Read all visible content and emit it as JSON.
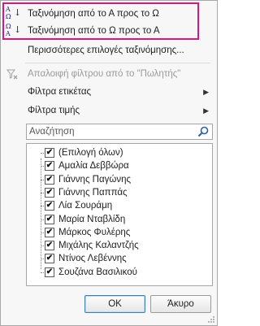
{
  "menu": {
    "sort_asc": "Ταξινόμηση από το Α προς το Ω",
    "sort_desc": "Ταξινόμηση από το Ω προς το Α",
    "more_sort": "Περισσότερες επιλογές ταξινόμησης...",
    "clear_filter": "Απαλοιφή φίλτρου από το \"Πωλητής\"",
    "label_filters": "Φίλτρα ετικέτας",
    "value_filters": "Φίλτρα τιμής",
    "sort_icon_top": "A",
    "sort_icon_bottom": "Ω",
    "sort_icon_top_desc": "Ω",
    "sort_icon_bottom_desc": "A",
    "submenu_arrow": "▶"
  },
  "search": {
    "placeholder": "Αναζήτηση"
  },
  "list": {
    "items": [
      {
        "label": "(Επιλογή όλων)",
        "checked": true
      },
      {
        "label": "Αμαλία Δεββώρα",
        "checked": true
      },
      {
        "label": "Γιάννης Παγώνης",
        "checked": true
      },
      {
        "label": "Γιάννης Παππάς",
        "checked": true
      },
      {
        "label": "Λία Σουράμη",
        "checked": true
      },
      {
        "label": "Μαρία Νταβλίδη",
        "checked": true
      },
      {
        "label": "Μάρκος Φυλέρης",
        "checked": true
      },
      {
        "label": "Μιχάλης Καλαντζής",
        "checked": true
      },
      {
        "label": "Ντίνος Λεβέννης",
        "checked": true
      },
      {
        "label": "Σουζάνα Βασιλικού",
        "checked": true
      }
    ]
  },
  "buttons": {
    "ok": "OK",
    "cancel": "Άκυρο"
  },
  "colors": {
    "highlight": "#d6187f"
  }
}
